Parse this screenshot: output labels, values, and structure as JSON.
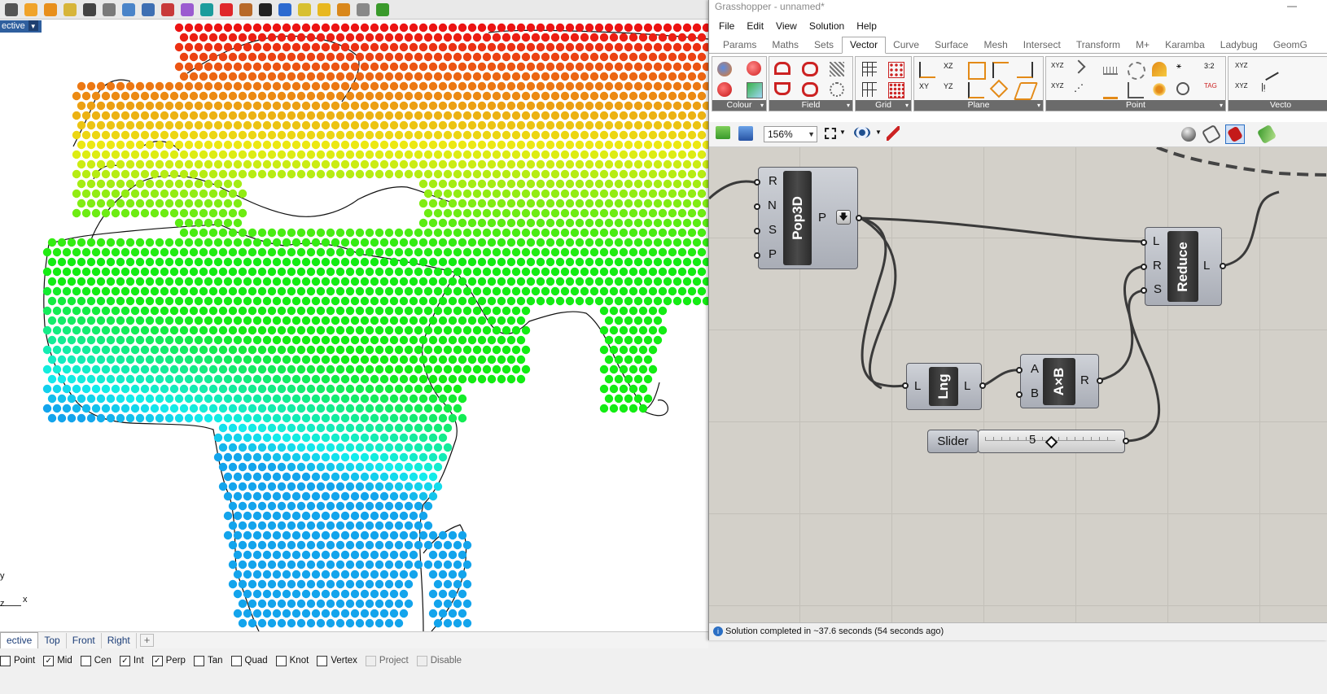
{
  "rhino": {
    "viewport_title": "ective",
    "axis_y": "y",
    "axis_z": "z",
    "axis_x": "x",
    "view_tabs": [
      "ective",
      "Top",
      "Front",
      "Right"
    ],
    "add_tab": "+"
  },
  "osnaps": [
    {
      "label": "Point",
      "checked": false
    },
    {
      "label": "Mid",
      "checked": true
    },
    {
      "label": "Cen",
      "checked": false
    },
    {
      "label": "Int",
      "checked": true
    },
    {
      "label": "Perp",
      "checked": true
    },
    {
      "label": "Tan",
      "checked": false
    },
    {
      "label": "Quad",
      "checked": false
    },
    {
      "label": "Knot",
      "checked": false
    },
    {
      "label": "Vertex",
      "checked": false
    },
    {
      "label": "Project",
      "checked": false,
      "disabled": true
    },
    {
      "label": "Disable",
      "checked": false,
      "disabled": true
    }
  ],
  "gh": {
    "title": "Grasshopper - unnamed*",
    "minimize": "—",
    "menu": [
      "File",
      "Edit",
      "View",
      "Solution",
      "Help"
    ],
    "tabs": [
      "Params",
      "Maths",
      "Sets",
      "Vector",
      "Curve",
      "Surface",
      "Mesh",
      "Intersect",
      "Transform",
      "M+",
      "Karamba",
      "Ladybug",
      "GeomG"
    ],
    "active_tab": "Vector",
    "ribbon_groups": [
      "Colour",
      "Field",
      "Grid",
      "Plane",
      "Point",
      "Vecto"
    ],
    "zoom": "156%",
    "status": "Solution completed in ~37.6 seconds (54 seconds ago)",
    "components": {
      "pop3d": {
        "name": "Pop3D",
        "inputs": [
          "R",
          "N",
          "S",
          "P"
        ],
        "output": "P"
      },
      "reduce": {
        "name": "Reduce",
        "inputs": [
          "L",
          "R",
          "S"
        ],
        "output": "L"
      },
      "lng": {
        "name": "Lng",
        "input": "L",
        "output": "L"
      },
      "mult": {
        "name": "A×B",
        "inputs": [
          "A",
          "B"
        ],
        "output": "R"
      },
      "slider": {
        "name": "Slider",
        "value": "5"
      }
    }
  },
  "colors": {
    "accent": "#2f5f9e",
    "canvas": "#d3d0c9",
    "component_core": "#333333"
  }
}
